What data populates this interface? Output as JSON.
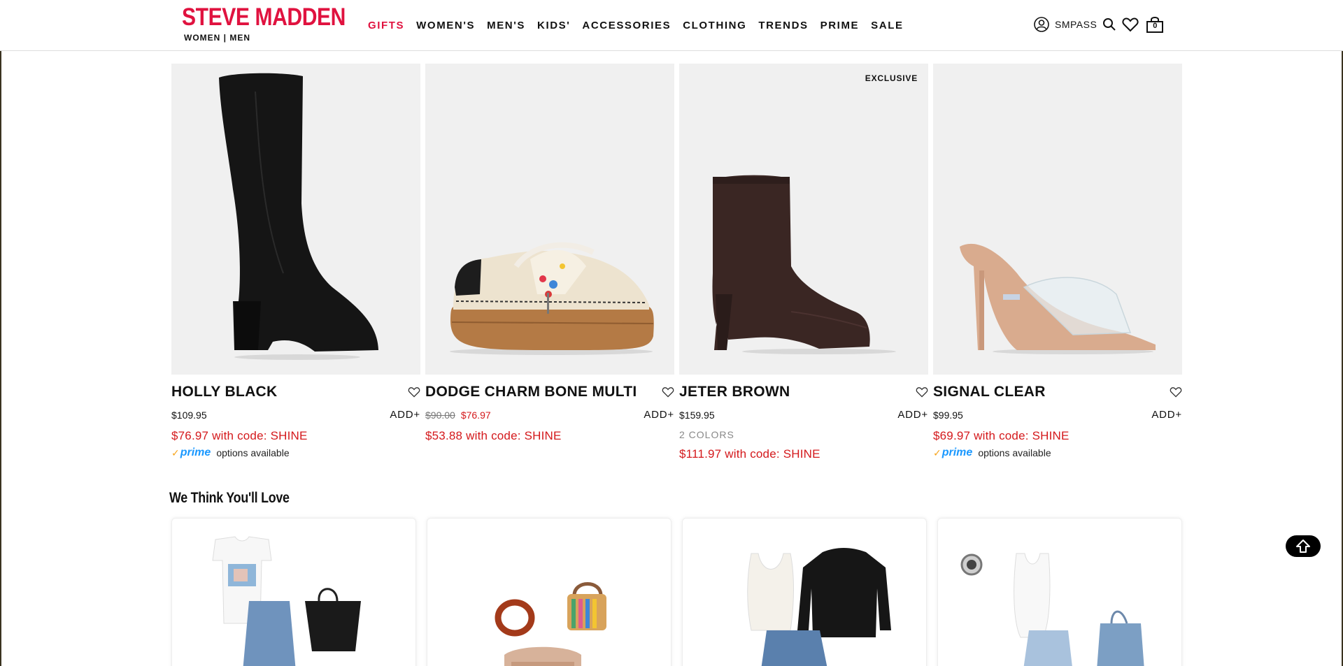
{
  "header": {
    "logo": "STEVE MADDEN",
    "logo_sub": "WOMEN | MEN",
    "nav": [
      "GIFTS",
      "WOMEN'S",
      "MEN'S",
      "KIDS'",
      "ACCESSORIES",
      "CLOTHING",
      "TRENDS",
      "PRIME",
      "SALE"
    ],
    "smpass": "SMPASS",
    "cart_count": "0"
  },
  "products": [
    {
      "name": "HOLLY BLACK",
      "price": "$109.95",
      "add": "ADD+",
      "promo": "$76.97 with code: SHINE",
      "prime_text": "options available"
    },
    {
      "name": "DODGE CHARM BONE MULTI",
      "original_price": "$90.00",
      "sale_price": "$76.97",
      "add": "ADD+",
      "promo": "$53.88 with code: SHINE"
    },
    {
      "name": "JETER BROWN",
      "badge": "EXCLUSIVE",
      "price": "$159.95",
      "add": "ADD+",
      "colors": "2 COLORS",
      "promo": "$111.97 with code: SHINE"
    },
    {
      "name": "SIGNAL CLEAR",
      "price": "$99.95",
      "add": "ADD+",
      "promo": "$69.97 with code: SHINE",
      "prime_text": "options available"
    }
  ],
  "prime_label": "prime",
  "section": {
    "title": "We Think You'll Love"
  },
  "colors": {
    "brand": "#e0123f",
    "sale": "#d4191c",
    "prime_blue": "#1a98ff",
    "prime_orange": "#f7a51c"
  }
}
